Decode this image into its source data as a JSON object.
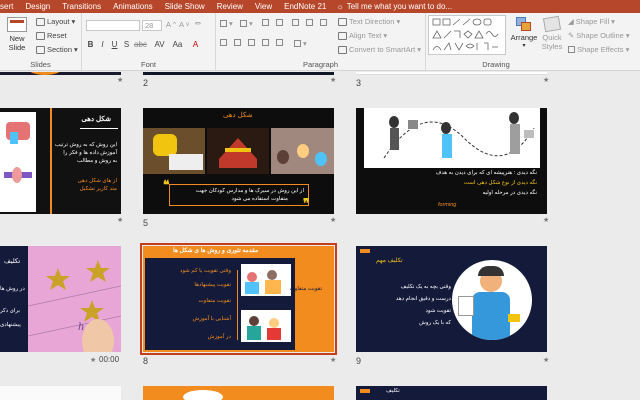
{
  "menu": {
    "items": [
      "sert",
      "Design",
      "Transitions",
      "Animations",
      "Slide Show",
      "Review",
      "View",
      "EndNote 21"
    ],
    "tell_me": "Tell me what you want to do..."
  },
  "ribbon": {
    "slides": {
      "new_slide": "New",
      "new_slide2": "Slide",
      "layout": "Layout",
      "reset": "Reset",
      "section": "Section",
      "label": "Slides"
    },
    "font": {
      "size": "28",
      "bold": "B",
      "italic": "I",
      "underline": "U",
      "strike": "S",
      "label": "Font"
    },
    "paragraph": {
      "text_direction": "Text Direction",
      "align_text": "Align Text",
      "convert": "Convert to SmartArt",
      "label": "Paragraph"
    },
    "drawing": {
      "arrange": "Arrange",
      "quick_styles_1": "Quick",
      "quick_styles_2": "Styles",
      "shape_fill": "Shape Fill",
      "shape_outline": "Shape Outline",
      "shape_effects": "Shape Effects",
      "label": "Drawing"
    }
  },
  "sorter": {
    "slide_numbers": [
      "2",
      "3",
      "5",
      "8",
      "9"
    ],
    "timing": "00:00",
    "slide4": {
      "title": "شكل دهی",
      "lines": [
        "این روش که به روش ترتیب",
        "آموزش داده ها و فکر را",
        "به روش و مطالب",
        "از هاى شکل دهی",
        "متد کاربر تشکیل"
      ]
    },
    "slide5": {
      "title": "شکل دهی",
      "caption1": "از این روش در سیرک ها و مدارس کودکان جهت",
      "caption2": "متفاوت استفاده می شود"
    },
    "slide6": {
      "caption1": "نگه دیدی : هنرپیشه ای که برای دیدن به هدف",
      "caption2": "نگه دیدی از نوع شکل دهی است",
      "caption3": "نگه دیدی در مرحله اولیه",
      "tag": "forming"
    },
    "slide7": {
      "title": "تکلیف",
      "l1": "در روش ها",
      "l2": "برای ذکر",
      "l3": "پیشنهادی"
    },
    "slide8": {
      "title": "مقدمه تئوری و روش ها ی شکل ها",
      "side": "تقویت متفاوت",
      "bullets": [
        "وقتی تقویت یا کم شود",
        "تقویت پیشنهادها",
        "تقویت متفاوت",
        "آشنایی با آموزش",
        "در آموزش"
      ]
    },
    "slide9": {
      "title": "تکلیف مهم",
      "l1": "وقتی بچه به یک تکلیف",
      "l2": "درست و دقیق انجام دهد",
      "l3": "تقویت شود",
      "l4": "که با یک روش"
    },
    "slide11": {
      "title": "تکلیف"
    }
  },
  "colors": {
    "accent": "#b7472a",
    "selection": "#c43e1c",
    "dark_navy": "#141a3a",
    "orange": "#f28c1e",
    "yellow_text": "#f5c518"
  }
}
